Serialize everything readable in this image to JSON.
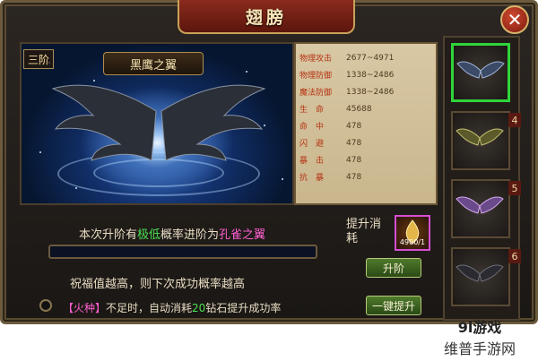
{
  "window": {
    "title": "翅膀"
  },
  "preview": {
    "tier": "三阶",
    "wing_name": "黑鹰之翼"
  },
  "stats": [
    {
      "name": "物理攻击",
      "value": "2677~4971"
    },
    {
      "name": "物理防御",
      "value": "1338~2486"
    },
    {
      "name": "魔法防御",
      "value": "1338~2486"
    },
    {
      "name": "生　命",
      "value": "45688"
    },
    {
      "name": "命　中",
      "value": "478"
    },
    {
      "name": "闪　避",
      "value": "478"
    },
    {
      "name": "暴　击",
      "value": "478"
    },
    {
      "name": "抗　暴",
      "value": "478"
    }
  ],
  "upgrade": {
    "chance_prefix": "本次升阶有",
    "chance_level": "极低",
    "chance_middle": "概率进阶为",
    "next_wing": "孔雀之翼",
    "cost_label": "提升消耗",
    "material_count": "4900/1",
    "progress": 0.0,
    "bless_text": "祝福值越高，则下次成功概率越高",
    "upgrade_button": "升阶",
    "onekey_button": "一键提升",
    "hint_tag": "【火种】",
    "hint_mid": "不足时，自动消耗",
    "hint_num": "20",
    "hint_end": "钻石提升成功率"
  },
  "wing_slots": [
    {
      "level": "",
      "selected": true
    },
    {
      "level": "4",
      "selected": false
    },
    {
      "level": "5",
      "selected": false
    },
    {
      "level": "6",
      "selected": false
    }
  ],
  "watermark": {
    "top": "9l游戏",
    "bottom": "维普手游网"
  }
}
